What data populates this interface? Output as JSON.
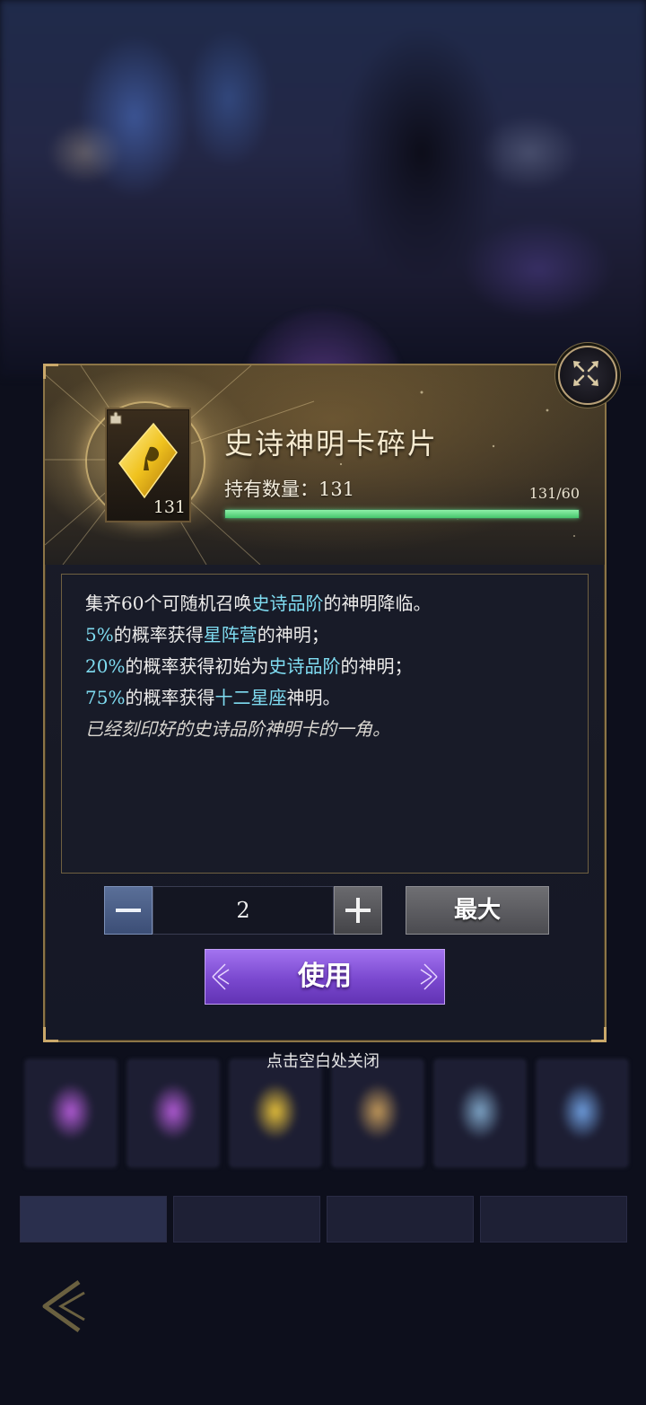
{
  "dialog": {
    "item_name": "史诗神明卡碎片",
    "item_badge_count": "131",
    "owned_label": "持有数量：131",
    "progress_text": "131/60",
    "progress_fraction": 1.0,
    "description": {
      "line1_a": "集齐60个可随机召唤",
      "line1_hl": "史诗品阶",
      "line1_b": "的神明降临。",
      "line2_hl1": "5%",
      "line2_a": "的概率获得",
      "line2_hl2": "星阵营",
      "line2_b": "的神明；",
      "line3_hl1": "20%",
      "line3_a": "的概率获得初始为",
      "line3_hl2": "史诗品阶",
      "line3_b": "的神明；",
      "line4_hl1": "75%",
      "line4_a": "的概率获得",
      "line4_hl2": "十二星座",
      "line4_b": "神明。",
      "line5": "已经刻印好的史诗品阶神明卡的一角。"
    },
    "stepper": {
      "value": "2"
    },
    "max_label": "最大",
    "use_label": "使用"
  },
  "dismiss_hint": "点击空白处关闭",
  "colors": {
    "highlight": "#7fdcf1",
    "use_button": "#7a48cf",
    "progress": "#46c66c",
    "frame_gold": "#8c7547"
  },
  "icons": [
    "close-icon",
    "fragment-icon",
    "puzzle-icon",
    "minus-icon",
    "plus-icon",
    "back-arrow-icon"
  ]
}
